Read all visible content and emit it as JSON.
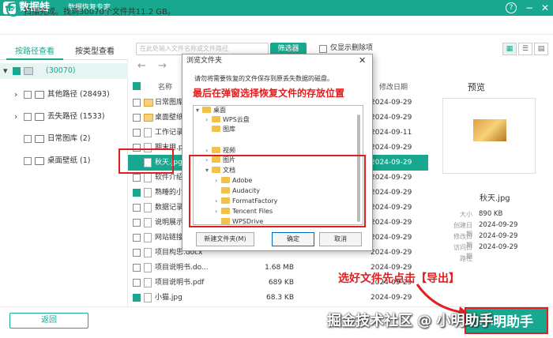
{
  "app": {
    "logo_glyph": "✚",
    "name": "数据蛙",
    "subtitle": "数据恢复专家"
  },
  "window_controls": {
    "help": "?",
    "minimize": "−",
    "close": "✕"
  },
  "status": {
    "icon": "✓",
    "text": "扫描完成。找到30070个文件共11.2 GB。"
  },
  "tabs": {
    "by_path": "按路径查看",
    "by_type": "按类型查看"
  },
  "toolbar": {
    "search_placeholder": "在此处输入文件名称或文件路径",
    "filter_label": "筛选器",
    "show_deleted_label": "仅显示删除项"
  },
  "tree": [
    {
      "label": "(30070)",
      "expand": "▾",
      "level": 0
    },
    {
      "label": "其他路径 (28493)",
      "expand": "›",
      "level": 1
    },
    {
      "label": "丢失路径 (1533)",
      "expand": "›",
      "level": 1
    },
    {
      "label": "日常图库 (2)",
      "expand": "",
      "level": 1
    },
    {
      "label": "桌面壁纸 (1)",
      "expand": "",
      "level": 1
    }
  ],
  "nav": {
    "back": "←",
    "forward": "→"
  },
  "file_table": {
    "headers": {
      "name": "名称",
      "modified": "修改日期"
    },
    "rows": [
      {
        "name": "日常图库",
        "size": "",
        "date": "2024-09-29"
      },
      {
        "name": "桌面壁纸",
        "size": "",
        "date": "2024-09-29"
      },
      {
        "name": "工作记录1",
        "size": "",
        "date": "2024-09-11"
      },
      {
        "name": "期末用.ppt",
        "size": "",
        "date": "2024-09-29"
      },
      {
        "name": "秋天.jpg",
        "size": "",
        "date": "2024-09-29"
      },
      {
        "name": "软件介绍",
        "size": "",
        "date": "2024-09-29"
      },
      {
        "name": "熟睡的小猫",
        "size": "",
        "date": "2024-09-29"
      },
      {
        "name": "数据记录表",
        "size": "",
        "date": "2024-09-29"
      },
      {
        "name": "说明展示.p",
        "size": "",
        "date": "2024-09-29"
      },
      {
        "name": "网站链接.t",
        "size": "",
        "date": "2024-09-29"
      },
      {
        "name": "项目构思.docx",
        "size": "",
        "date": "2024-09-29"
      },
      {
        "name": "项目说明书.do...",
        "size": "1.68 MB",
        "date": "2024-09-29"
      },
      {
        "name": "项目说明书.pdf",
        "size": "689 KB",
        "date": "2024-09-29"
      },
      {
        "name": "小猫.jpg",
        "size": "68.3 KB",
        "date": "2024-09-29"
      }
    ]
  },
  "preview": {
    "title": "预览",
    "file_name": "秋天.jpg",
    "size_label": "大小",
    "size_value": "890 KB",
    "created_label": "创建日期",
    "created_value": "2024-09-29",
    "modified_label": "修改日期",
    "modified_value": "2024-09-29",
    "accessed_label": "访问日期",
    "accessed_value": "2024-09-29",
    "path_label": "路径"
  },
  "dialog": {
    "title": "浏览文件夹",
    "close": "✕",
    "instruction": "请勿将需要恢复的文件保存到原丢失数据的磁盘。",
    "annotation": "最后在弹窗选择恢复文件的存放位置",
    "tree": [
      {
        "label": "桌面",
        "expand": "▾"
      },
      {
        "label": "WPS云盘",
        "expand": "›"
      },
      {
        "label": "图库",
        "expand": ""
      },
      {
        "label": "视频",
        "expand": "›"
      },
      {
        "label": "图片",
        "expand": "›"
      },
      {
        "label": "文档",
        "expand": "▾"
      },
      {
        "label": "Adobe",
        "expand": "›"
      },
      {
        "label": "Audacity",
        "expand": ""
      },
      {
        "label": "FormatFactory",
        "expand": "›"
      },
      {
        "label": "Tencent Files",
        "expand": "›"
      },
      {
        "label": "WPSDrive",
        "expand": ""
      }
    ],
    "new_folder": "新建文件夹(M)",
    "ok": "确定",
    "cancel": "取消"
  },
  "bottom": {
    "back": "返回",
    "export": "小明助手"
  },
  "annotations": {
    "export_hint": "选好文件先点击【导出】",
    "watermark": "掘金技术社区 @ 小明助手"
  },
  "colors": {
    "accent": "#17a88f",
    "annotation_red": "#e02020"
  }
}
